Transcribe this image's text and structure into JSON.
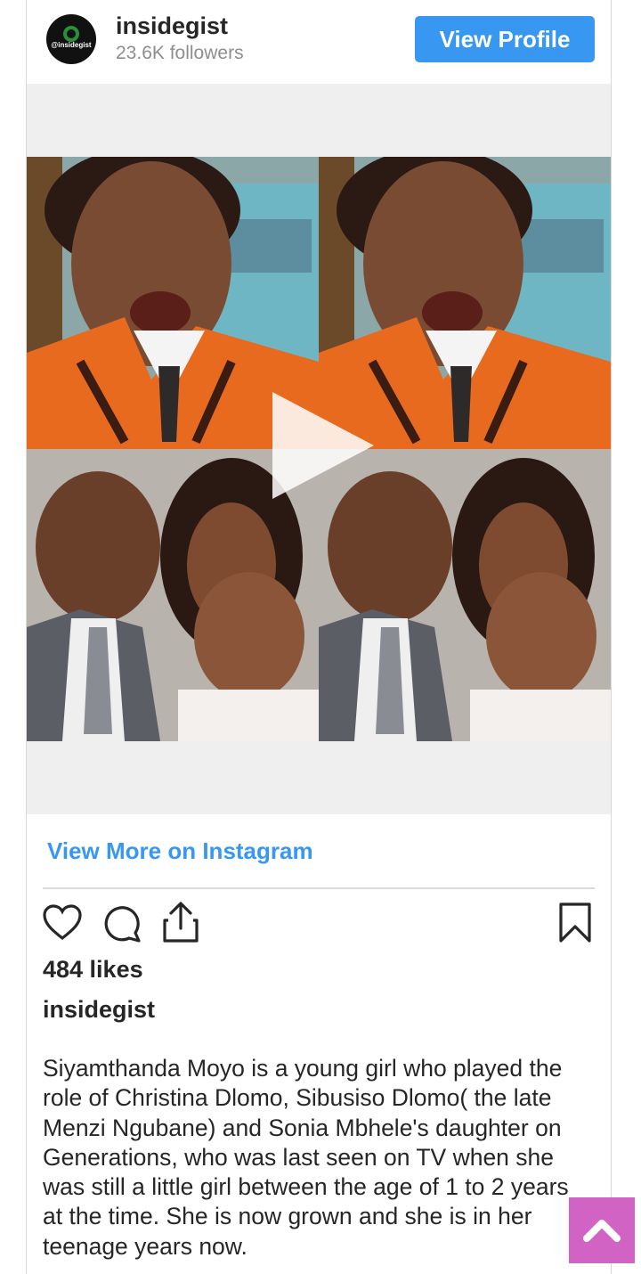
{
  "header": {
    "avatar_text": "@insidegist",
    "username": "insidegist",
    "followers": "23.6K followers",
    "view_profile_label": "View Profile"
  },
  "media": {
    "type": "video",
    "play_icon": "play-icon"
  },
  "links": {
    "view_more": "View More on Instagram"
  },
  "actions": {
    "icons": [
      "heart-icon",
      "comment-icon",
      "share-icon",
      "bookmark-icon"
    ]
  },
  "post": {
    "likes": "484 likes",
    "owner": "insidegist",
    "caption": "Siyamthanda Moyo is a young girl who played the role of Christina Dlomo, Sibusiso Dlomo( the late Menzi Ngubane) and Sonia Mbhele's daughter on Generations, who was last seen on TV when she was still a little girl between the age of 1 to 2 years at the time. She is now grown and she is in her teenage years now."
  },
  "colors": {
    "accent": "#3897f0",
    "scroll_button": "#d063c4",
    "border": "#dbdbdb"
  }
}
